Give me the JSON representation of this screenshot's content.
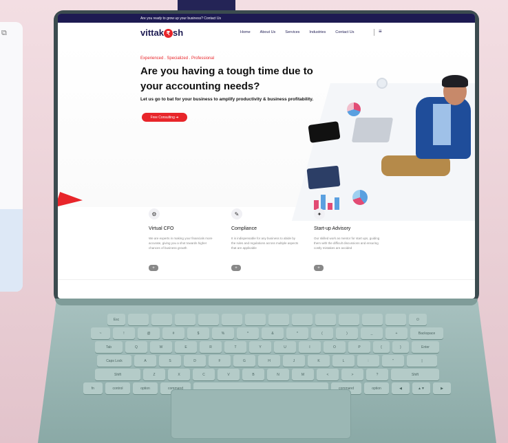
{
  "site": {
    "topbar_text": "Are you ready to grow up your business? Contact Us",
    "logo_left": "vittak",
    "logo_symbol": "₹",
    "logo_right": "sh",
    "nav": [
      "Home",
      "About Us",
      "Services",
      "Industries",
      "Contact Us"
    ],
    "menu_icon": "hamburger-icon"
  },
  "hero": {
    "tagline": "Experienced . Specialized . Professional",
    "headline": "Are you having a tough time due to your accounting needs?",
    "subline": "Let us go to bat for your business to amplify productivity & business profitability.",
    "cta_label": "Free Consulting ➔"
  },
  "services": [
    {
      "icon": "team-icon",
      "title": "Virtual CFO",
      "desc": "We are experts in making your financials more accurate, giving you a shot towards higher chances of business growth"
    },
    {
      "icon": "compliance-icon",
      "title": "Compliance",
      "desc": "It is indispensable for any business to abide by the rules and regulations across multiple aspects that are applicable"
    },
    {
      "icon": "rocket-icon",
      "title": "Start-up Advisory",
      "desc": "Our skilled work as mentor for start ups, guiding them with the difficult discussions and ensuring costly mistakes are avoided"
    }
  ],
  "keyboard": {
    "row1": [
      "Esc",
      "",
      "",
      "",
      "",
      "",
      "",
      "",
      "",
      "",
      "",
      "",
      "",
      "⏻"
    ],
    "row2": [
      "~",
      "!",
      "@",
      "#",
      "$",
      "%",
      "^",
      "&",
      "*",
      "(",
      ")",
      "_",
      "+",
      "Backspace"
    ],
    "row3": [
      "Tab",
      "Q",
      "W",
      "E",
      "R",
      "T",
      "Y",
      "U",
      "I",
      "O",
      "P",
      "{",
      "}",
      "Enter"
    ],
    "row4": [
      "Caps Lock",
      "A",
      "S",
      "D",
      "F",
      "G",
      "H",
      "J",
      "K",
      "L",
      ":",
      "\"",
      "|"
    ],
    "row5": [
      "Shift",
      "Z",
      "X",
      "C",
      "V",
      "B",
      "N",
      "M",
      "<",
      ">",
      "?",
      "Shift"
    ],
    "row6": [
      "fn",
      "control",
      "option",
      "command",
      "",
      "command",
      "option",
      "◀",
      "▲▼",
      "▶"
    ]
  }
}
